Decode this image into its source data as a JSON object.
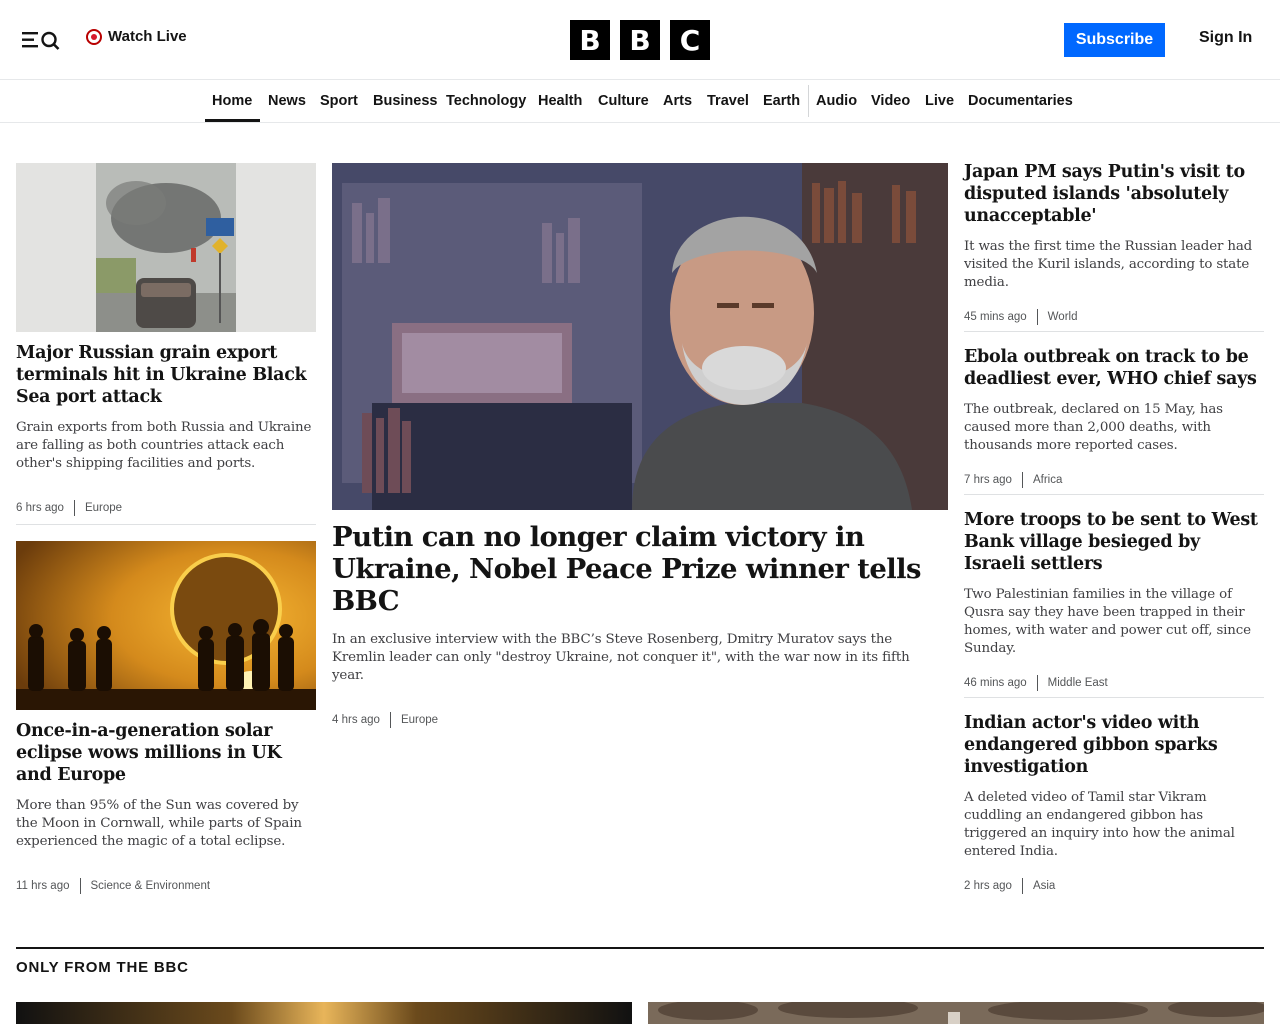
{
  "header": {
    "watch_live": "Watch Live",
    "logo_letters": [
      "B",
      "B",
      "C"
    ],
    "subscribe": "Subscribe",
    "sign_in": "Sign In"
  },
  "nav": {
    "items": [
      "Home",
      "News",
      "Sport",
      "Business",
      "Technology",
      "Health",
      "Culture",
      "Arts",
      "Travel",
      "Earth",
      "Audio",
      "Video",
      "Live",
      "Documentaries"
    ],
    "active": "Home"
  },
  "left": [
    {
      "headline": "Major Russian grain export terminals hit in Ukraine Black Sea port attack",
      "summary": "Grain exports from both Russia and Ukraine are falling as both countries attack each other's shipping facilities and ports.",
      "time": "6 hrs ago",
      "section": "Europe"
    },
    {
      "headline": "Once-in-a-generation solar eclipse wows millions in UK and Europe",
      "summary": "More than 95% of the Sun was covered by the Moon in Cornwall, while parts of Spain experienced the magic of a total eclipse.",
      "time": "11 hrs ago",
      "section": "Science & Environment"
    }
  ],
  "main": {
    "headline": "Putin can no longer claim victory in Ukraine, Nobel Peace Prize winner tells BBC",
    "summary": "In an exclusive interview with the BBC’s Steve Rosenberg, Dmitry Muratov says the Kremlin leader can only \"destroy Ukraine, not conquer it\", with the war now in its fifth year.",
    "time": "4 hrs ago",
    "section": "Europe"
  },
  "right": [
    {
      "headline": "Japan PM says Putin's visit to disputed islands 'absolutely unacceptable'",
      "summary": "It was the first time the Russian leader had visited the Kuril islands, according to state media.",
      "time": "45 mins ago",
      "section": "World"
    },
    {
      "headline": "Ebola outbreak on track to be deadliest ever, WHO chief says",
      "summary": "The outbreak, declared on 15 May, has caused more than 2,000 deaths, with thousands more reported cases.",
      "time": "7 hrs ago",
      "section": "Africa"
    },
    {
      "headline": "More troops to be sent to West Bank village besieged by Israeli settlers",
      "summary": "Two Palestinian families in the village of Qusra say they have been trapped in their homes, with water and power cut off, since Sunday.",
      "time": "46 mins ago",
      "section": "Middle East"
    },
    {
      "headline": "Indian actor's video with endangered gibbon sparks investigation",
      "summary": "A deleted video of Tamil star Vikram cuddling an endangered gibbon has triggered an inquiry into how the animal entered India.",
      "time": "2 hrs ago",
      "section": "Asia"
    }
  ],
  "only_from_bbc": {
    "title": "ONLY FROM THE BBC"
  }
}
